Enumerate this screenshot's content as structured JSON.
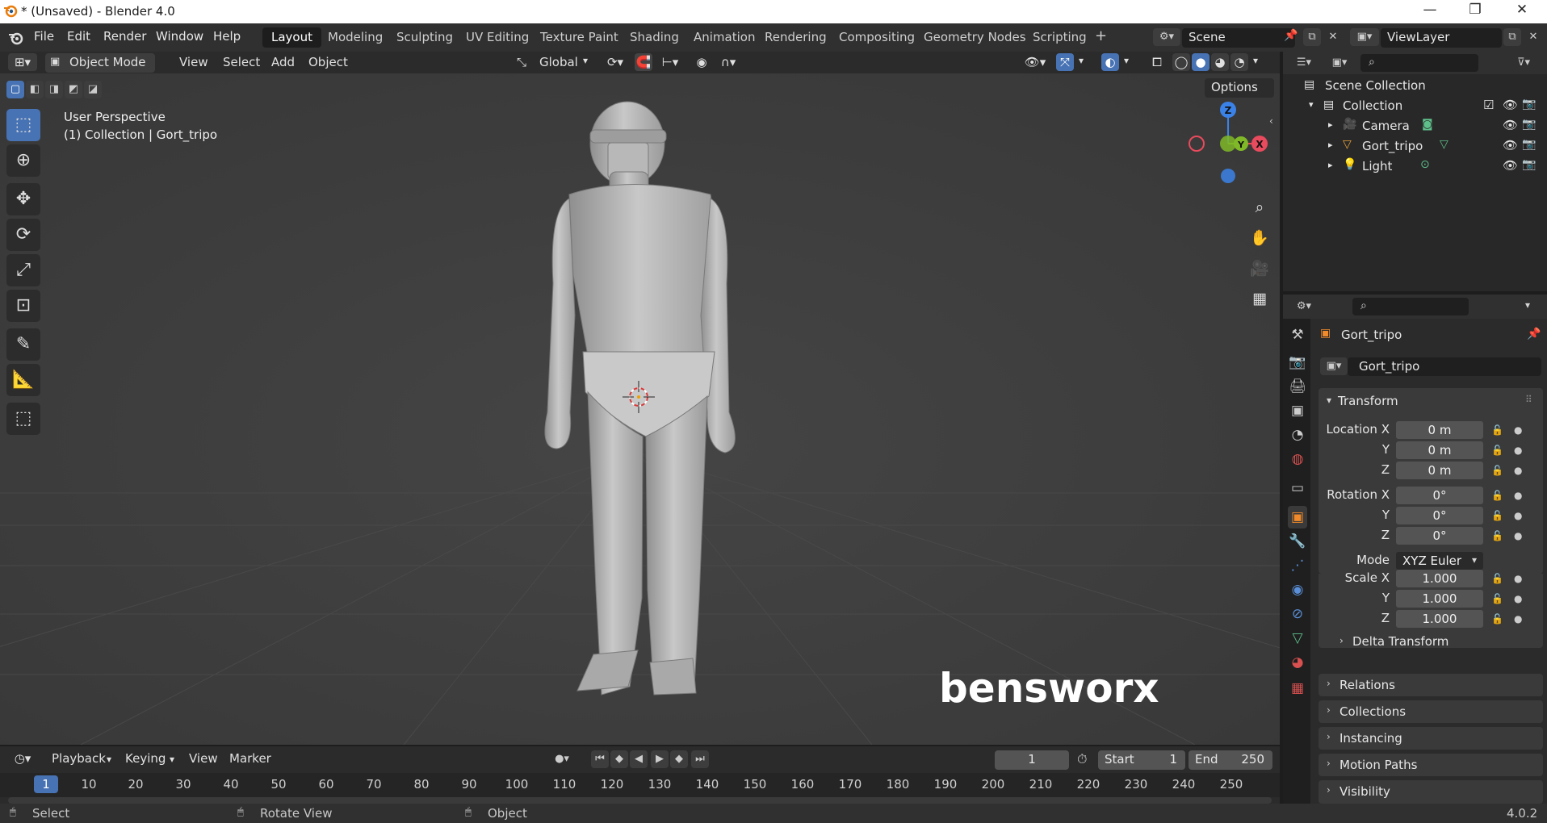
{
  "window": {
    "title": "* (Unsaved) - Blender 4.0",
    "minimize": "—",
    "maximize": "❐",
    "close": "✕"
  },
  "menu": [
    "File",
    "Edit",
    "Render",
    "Window",
    "Help"
  ],
  "workspaces": [
    "Layout",
    "Modeling",
    "Sculpting",
    "UV Editing",
    "Texture Paint",
    "Shading",
    "Animation",
    "Rendering",
    "Compositing",
    "Geometry Nodes",
    "Scripting"
  ],
  "active_workspace": "Layout",
  "add_workspace": "+",
  "scene": {
    "label": "Scene"
  },
  "view_layer": {
    "label": "ViewLayer"
  },
  "viewport_header": {
    "mode": "Object Mode",
    "items": [
      "View",
      "Select",
      "Add",
      "Object"
    ],
    "orientation": "Global",
    "options": "Options"
  },
  "viewport": {
    "perspective": "User Perspective",
    "context": "(1) Collection | Gort_tripo",
    "watermark": "bensworx",
    "gizmo": {
      "z": "Z",
      "y": "Y",
      "x": "X"
    }
  },
  "outliner": {
    "scene_collection": "Scene Collection",
    "collection": "Collection",
    "items": [
      "Camera",
      "Gort_tripo",
      "Light"
    ]
  },
  "properties": {
    "object_name": "Gort_tripo",
    "object_field": "Gort_tripo",
    "transform_label": "Transform",
    "location_label": "Location X",
    "rotation_label": "Rotation X",
    "scale_label": "Scale X",
    "mode_label": "Mode",
    "axis_y": "Y",
    "axis_z": "Z",
    "location": [
      "0 m",
      "0 m",
      "0 m"
    ],
    "rotation": [
      "0°",
      "0°",
      "0°"
    ],
    "mode": "XYZ Euler",
    "scale": [
      "1.000",
      "1.000",
      "1.000"
    ],
    "sections": [
      "Delta Transform",
      "Relations",
      "Collections",
      "Instancing",
      "Motion Paths",
      "Visibility"
    ]
  },
  "timeline": {
    "menus": [
      "Playback",
      "Keying",
      "View",
      "Marker"
    ],
    "current_frame": "1",
    "start_label": "Start",
    "start": "1",
    "end_label": "End",
    "end": "250",
    "ticks": [
      "1",
      "10",
      "20",
      "30",
      "40",
      "50",
      "60",
      "70",
      "80",
      "90",
      "100",
      "110",
      "120",
      "130",
      "140",
      "150",
      "160",
      "170",
      "180",
      "190",
      "200",
      "210",
      "220",
      "230",
      "240",
      "250"
    ]
  },
  "status": {
    "select": "Select",
    "rotate": "Rotate View",
    "object": "Object",
    "version": "4.0.2"
  },
  "colors": {
    "accent": "#4772b3",
    "x_axis": "#e84b5d",
    "y_axis": "#7fb928",
    "z_axis": "#3b82e8"
  }
}
